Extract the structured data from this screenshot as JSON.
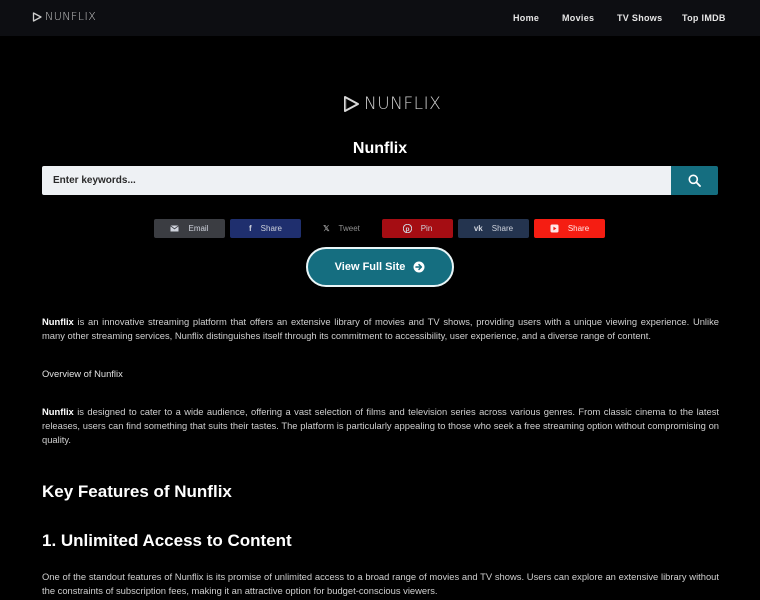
{
  "header": {
    "logo_text": "NUNFLIX",
    "nav": [
      "Home",
      "Movies",
      "TV Shows",
      "Top IMDB"
    ]
  },
  "hero": {
    "logo_text": "NUNFLIX",
    "title": "Nunflix"
  },
  "search": {
    "placeholder": "Enter keywords..."
  },
  "share_buttons": [
    {
      "label": "Email",
      "icon": "envelope-icon",
      "color": "#3b3d42"
    },
    {
      "label": "Share",
      "icon": "facebook-icon",
      "color": "#1f2f6e"
    },
    {
      "label": "Tweet",
      "icon": "x-icon",
      "color": "#000000"
    },
    {
      "label": "Pin",
      "icon": "pinterest-icon",
      "color": "#a50d13"
    },
    {
      "label": "Share",
      "icon": "vk-icon",
      "color": "#24344f"
    },
    {
      "label": "Share",
      "icon": "youtube-icon",
      "color": "#f51d12"
    }
  ],
  "cta": {
    "label": "View Full Site",
    "color": "#156e80"
  },
  "content": {
    "p1_strong": "Nunflix",
    "p1_text": " is an innovative streaming platform that offers an extensive library of movies and TV shows, providing users with a unique viewing experience. Unlike many other streaming services, Nunflix distinguishes itself through its commitment to accessibility, user experience, and a diverse range of content.",
    "overview_heading": "Overview of Nunflix",
    "p2_strong": "Nunflix",
    "p2_text": " is designed to cater to a wide audience, offering a vast selection of films and television series across various genres. From classic cinema to the latest releases, users can find something that suits their tastes. The platform is particularly appealing to those who seek a free streaming option without compromising on quality.",
    "features_heading": "Key Features of Nunflix",
    "feature1_heading": "1. Unlimited Access to Content",
    "p3_text": "One of the standout features of Nunflix is its promise of unlimited access to a broad range of movies and TV shows. Users can explore an extensive library without the constraints of subscription fees, making it an attractive option for budget-conscious viewers."
  }
}
